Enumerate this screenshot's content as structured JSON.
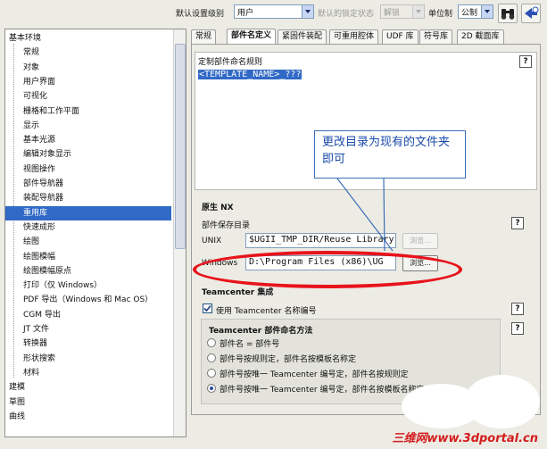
{
  "toolbar": {
    "default_level_label": "默认设置级别",
    "default_level_value": "用户",
    "lock_status_label": "默认的锁定状态",
    "lock_status_value": "解锁",
    "unit_label": "单位制",
    "unit_value": "公制"
  },
  "tree": {
    "items": [
      {
        "label": "基本环境",
        "level": 0
      },
      {
        "label": "常规",
        "level": 1
      },
      {
        "label": "对象",
        "level": 1
      },
      {
        "label": "用户界面",
        "level": 1
      },
      {
        "label": "可视化",
        "level": 1
      },
      {
        "label": "栅格和工作平面",
        "level": 1
      },
      {
        "label": "显示",
        "level": 1
      },
      {
        "label": "基本光源",
        "level": 1
      },
      {
        "label": "编辑对象显示",
        "level": 1
      },
      {
        "label": "视图操作",
        "level": 1
      },
      {
        "label": "部件导航器",
        "level": 1
      },
      {
        "label": "装配导航器",
        "level": 1
      },
      {
        "label": "重用库",
        "level": 1,
        "selected": true
      },
      {
        "label": "快速成形",
        "level": 1
      },
      {
        "label": "绘图",
        "level": 1
      },
      {
        "label": "绘图模幅",
        "level": 1
      },
      {
        "label": "绘图模幅原点",
        "level": 1
      },
      {
        "label": "打印（仅 Windows）",
        "level": 1
      },
      {
        "label": "PDF 导出（Windows 和 Mac OS）",
        "level": 1
      },
      {
        "label": "CGM 导出",
        "level": 1
      },
      {
        "label": "JT 文件",
        "level": 1
      },
      {
        "label": "转换器",
        "level": 1
      },
      {
        "label": "形状搜索",
        "level": 1
      },
      {
        "label": "材料",
        "level": 1
      },
      {
        "label": "建模",
        "level": 0
      },
      {
        "label": "草图",
        "level": 0
      },
      {
        "label": "曲线",
        "level": 0
      }
    ]
  },
  "tabs": [
    {
      "label": "常规"
    },
    {
      "label": "部件名定义",
      "active": true
    },
    {
      "label": "紧固件装配"
    },
    {
      "label": "可重用腔体"
    },
    {
      "label": "UDF 库"
    },
    {
      "label": "符号库"
    },
    {
      "label": "2D 截面库"
    }
  ],
  "naming_rule": {
    "title": "定制部件命名规则",
    "value": "<TEMPLATE_NAME>_???"
  },
  "native_nx": {
    "title": "原生 NX",
    "dir_label": "部件保存目录",
    "unix_label": "UNIX",
    "unix_value": "$UGII_TMP_DIR/Reuse Library",
    "unix_browse": "浏览...",
    "windows_label": "Windows",
    "windows_value": "D:\\Program Files (x86)\\UG",
    "windows_browse": "浏览..."
  },
  "teamcenter": {
    "title": "Teamcenter 集成",
    "use_numbering_label": "使用 Teamcenter 名称编号",
    "use_numbering_checked": true,
    "method_title": "Teamcenter 部件命名方法",
    "options": [
      {
        "label": "部件名 = 部件号",
        "checked": false
      },
      {
        "label": "部件号按规则定，部件名按模板名称定",
        "checked": false
      },
      {
        "label": "部件号按唯一 Teamcenter 编号定，部件名按规则定",
        "checked": false
      },
      {
        "label": "部件号按唯一 Teamcenter 编号定，部件名按模板名称定",
        "checked": true
      }
    ]
  },
  "annotation": {
    "text": "更改目录为现有的文件夹即可"
  },
  "watermark": "三维网www.3dportal.cn",
  "colors": {
    "selection": "#3169c6",
    "annotation_oval": "#e8131b",
    "annotation_text": "#1a4aa8"
  }
}
